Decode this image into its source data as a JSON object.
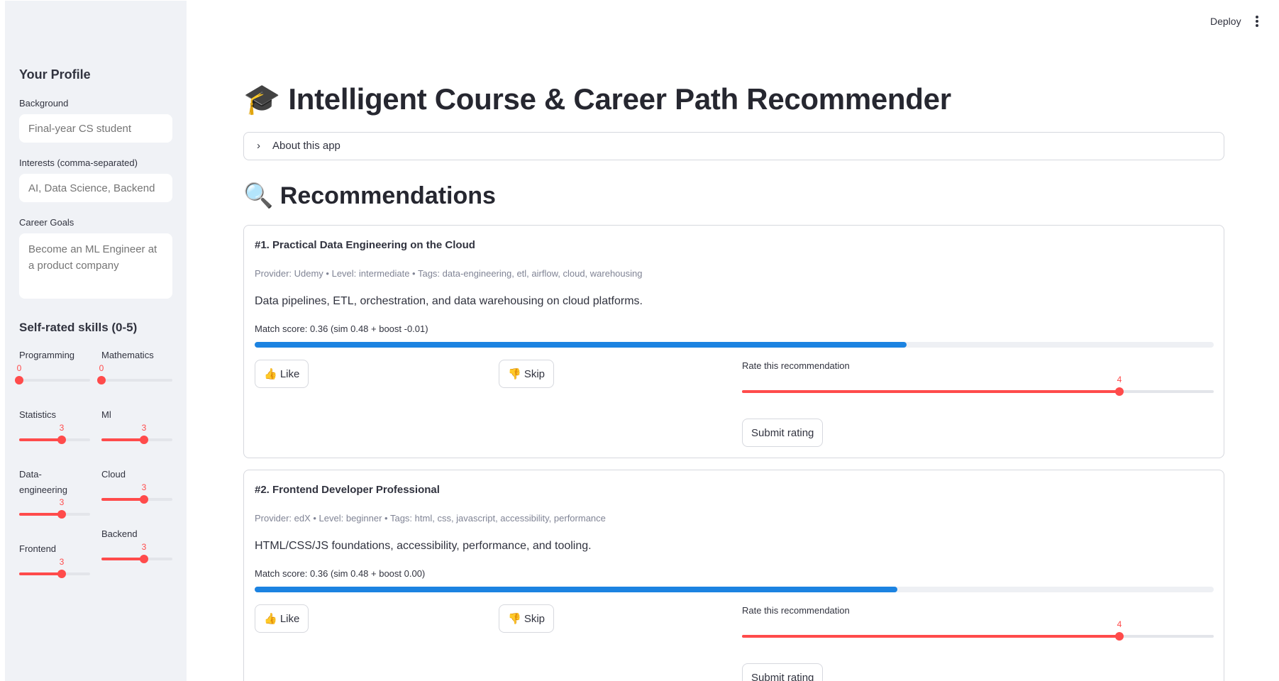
{
  "header": {
    "deploy_label": "Deploy",
    "menu_icon": "vertical-ellipsis-icon"
  },
  "sidebar": {
    "title": "Your Profile",
    "background": {
      "label": "Background",
      "placeholder": "Final-year CS student",
      "value": ""
    },
    "interests": {
      "label": "Interests (comma-separated)",
      "placeholder": "AI, Data Science, Backend",
      "value": ""
    },
    "career_goals": {
      "label": "Career Goals",
      "placeholder": "Become an ML Engineer at a product company",
      "value": ""
    },
    "skills_title": "Self-rated skills (0-5)",
    "skills_max": 5,
    "skills": [
      {
        "name": "Programming",
        "value": 0
      },
      {
        "name": "Mathematics",
        "value": 0
      },
      {
        "name": "Statistics",
        "value": 3
      },
      {
        "name": "Ml",
        "value": 3
      },
      {
        "name": "Data-engineering",
        "value": 3
      },
      {
        "name": "Cloud",
        "value": 3
      },
      {
        "name": "Frontend",
        "value": 3
      },
      {
        "name": "Backend",
        "value": 3
      }
    ]
  },
  "main": {
    "title": "🎓 Intelligent Course & Career Path Recommender",
    "expander_label": "About this app",
    "section_title": "🔍 Recommendations",
    "like_label": "👍 Like",
    "skip_label": "👎 Skip",
    "rate_label": "Rate this recommendation",
    "submit_label": "Submit rating",
    "rating_max": 5,
    "recommendations": [
      {
        "title": "#1. Practical Data Engineering on the Cloud",
        "meta": "Provider: Udemy • Level: intermediate • Tags: data-engineering, etl, airflow, cloud, warehousing",
        "description": "Data pipelines, ETL, orchestration, and data warehousing on cloud platforms.",
        "score_text": "Match score: 0.36 (sim 0.48 + boost -0.01)",
        "progress": 0.68,
        "rating": 4
      },
      {
        "title": "#2. Frontend Developer Professional",
        "meta": "Provider: edX • Level: beginner • Tags: html, css, javascript, accessibility, performance",
        "description": "HTML/CSS/JS foundations, accessibility, performance, and tooling.",
        "score_text": "Match score: 0.36 (sim 0.48 + boost 0.00)",
        "progress": 0.67,
        "rating": 4
      }
    ]
  },
  "colors": {
    "accent": "#ff4b4b",
    "progress": "#1c83e1",
    "sidebar_bg": "#f0f2f6"
  }
}
